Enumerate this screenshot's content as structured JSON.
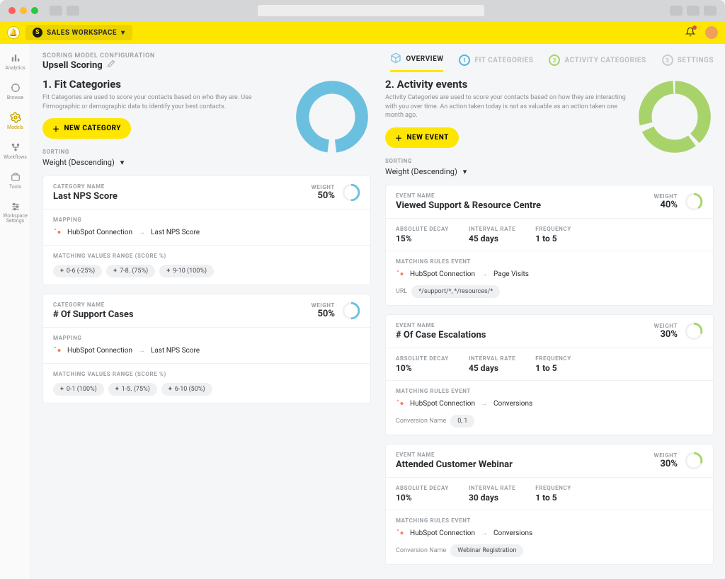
{
  "chrome": {
    "dots": [
      "#ff5f57",
      "#febc2e",
      "#28c840"
    ]
  },
  "topbar": {
    "workspace_label": "SALES WORKSPACE"
  },
  "sidenav": [
    {
      "id": "analytics",
      "label": "Analytics",
      "active": false
    },
    {
      "id": "browse",
      "label": "Browse",
      "active": false
    },
    {
      "id": "models",
      "label": "Models",
      "active": true
    },
    {
      "id": "workflows",
      "label": "Workflows",
      "active": false
    },
    {
      "id": "tools",
      "label": "Tools",
      "active": false
    },
    {
      "id": "wssettings",
      "label": "Workspace Settings",
      "active": false
    }
  ],
  "header": {
    "crumb": "SCORING MODEL CONFIGURATION",
    "title": "Upsell Scoring"
  },
  "tabs": {
    "overview": "OVERVIEW",
    "fit": "FIT CATEGORIES",
    "activity": "ACTIVITY CATEGORIES",
    "settings": "SETTINGS"
  },
  "fit": {
    "title": "1. Fit Categories",
    "desc": "Fit Categories are used to score your contacts based on who they are. Use Firmographic or demographic data to identify your best contacts.",
    "new_btn": "NEW CATEGORY",
    "sorting_label": "SORTING",
    "sorting_value": "Weight (Descending)",
    "donut_color": "#6cc0df",
    "labels": {
      "category_name": "CATEGORY NAME",
      "weight": "WEIGHT",
      "mapping": "MAPPING",
      "matching": "MATCHING VALUES RANGE (SCORE %)"
    },
    "cards": [
      {
        "name": "Last NPS Score",
        "weight": "50%",
        "mapping_source": "HubSpot Connection",
        "mapping_target": "Last NPS Score",
        "chips": [
          "0-6 (-25%)",
          "7-8. (75%)",
          "9-10 (100%)"
        ]
      },
      {
        "name": "# Of Support Cases",
        "weight": "50%",
        "mapping_source": "HubSpot Connection",
        "mapping_target": "Last NPS Score",
        "chips": [
          "0-1 (100%)",
          "1-5. (75%)",
          "6-10 (50%)"
        ]
      }
    ]
  },
  "activity": {
    "title": "2. Activity events",
    "desc": "Activity Categories are used to score your contacts based on how they are interacting with you over time. An action taken today is not as valuable as an action taken one month ago.",
    "new_btn": "NEW EVENT",
    "sorting_label": "SORTING",
    "sorting_value": "Weight (Descending)",
    "donut_color": "#a8d36a",
    "labels": {
      "event_name": "EVENT NAME",
      "weight": "WEIGHT",
      "abs_decay": "ABSOLUTE DECAY",
      "interval": "INTERVAL RATE",
      "frequency": "FREQUENCY",
      "matching": "MATCHING RULES EVENT",
      "url": "URL",
      "conv_name": "Conversion Name"
    },
    "cards": [
      {
        "name": "Viewed Support & Resource Centre",
        "weight": "40%",
        "abs_decay": "15%",
        "interval": "45 days",
        "frequency": "1 to 5",
        "mapping_source": "HubSpot Connection",
        "mapping_target": "Page Visits",
        "extra_label": "url",
        "extra_chip": "*/support/*, */resources/*"
      },
      {
        "name": "# Of Case Escalations",
        "weight": "30%",
        "abs_decay": "10%",
        "interval": "45 days",
        "frequency": "1 to 5",
        "mapping_source": "HubSpot Connection",
        "mapping_target": "Conversions",
        "extra_label": "conv_name",
        "extra_chip": "0, 1"
      },
      {
        "name": "Attended Customer Webinar",
        "weight": "30%",
        "abs_decay": "10%",
        "interval": "30 days",
        "frequency": "1 to 5",
        "mapping_source": "HubSpot Connection",
        "mapping_target": "Conversions",
        "extra_label": "conv_name",
        "extra_chip": "Webinar Registration"
      }
    ]
  }
}
